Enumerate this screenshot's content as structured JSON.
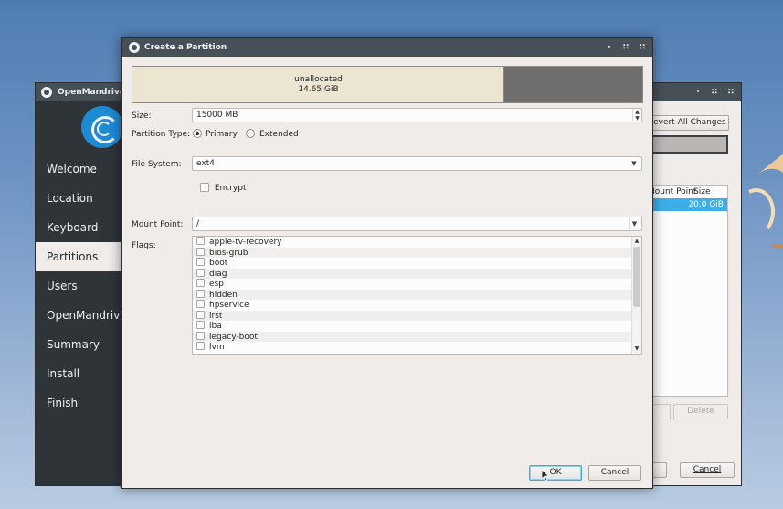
{
  "background_window": {
    "title": "OpenMandriva",
    "nav_items": [
      "Welcome",
      "Location",
      "Keyboard",
      "Partitions",
      "Users",
      "OpenMandriva",
      "Summary",
      "Install",
      "Finish"
    ],
    "active_nav": "Partitions",
    "revert_all_label": "Revert All Changes",
    "table_headers": [
      "Mount Point",
      "Size"
    ],
    "selected_row_size": "20.0 GiB",
    "delete_label": "Delete",
    "cancel_label": "Cancel"
  },
  "dialog": {
    "title": "Create a Partition",
    "partition_bar": {
      "label": "unallocated",
      "size": "14.65 GiB",
      "new_partition_fraction": 0.73
    },
    "size": {
      "label": "Size:",
      "value": "15000 MB"
    },
    "partition_type": {
      "label": "Partition Type:",
      "options": [
        "Primary",
        "Extended"
      ],
      "selected": "Primary"
    },
    "file_system": {
      "label": "File System:",
      "value": "ext4"
    },
    "encrypt": {
      "label": "Encrypt",
      "checked": false
    },
    "mount_point": {
      "label": "Mount Point:",
      "value": "/"
    },
    "flags": {
      "label": "Flags:",
      "items": [
        "apple-tv-recovery",
        "bios-grub",
        "boot",
        "diag",
        "esp",
        "hidden",
        "hpservice",
        "irst",
        "lba",
        "legacy-boot",
        "lvm"
      ]
    },
    "ok_label": "OK",
    "cancel_label": "Cancel"
  },
  "colors": {
    "titlebar": "#475057",
    "sidebar": "#2f3439",
    "selection": "#3daee9",
    "window_bg": "#efecea",
    "logo": "#1d8ad4"
  }
}
